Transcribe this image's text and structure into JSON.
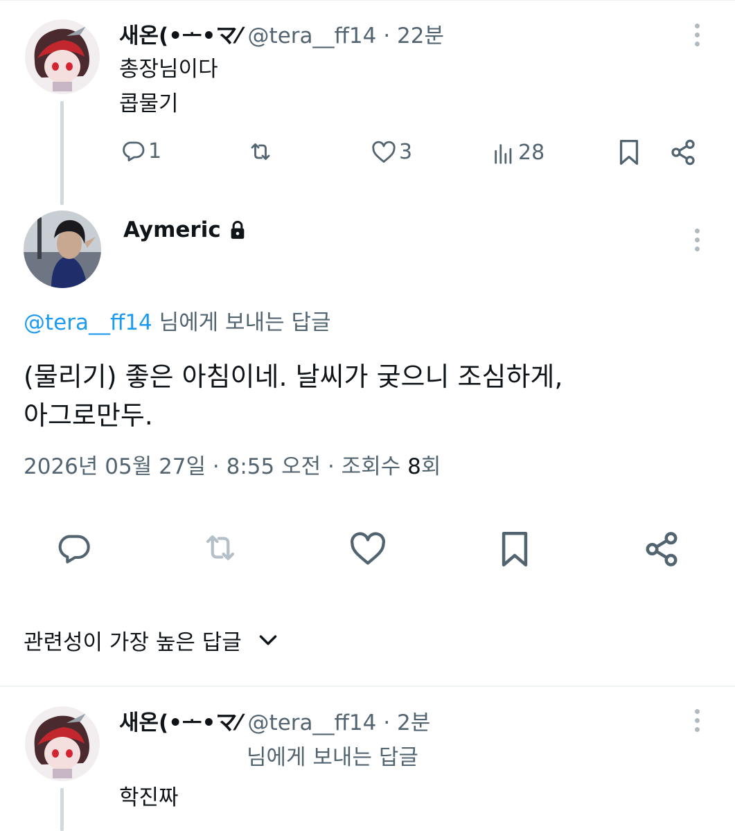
{
  "parent_tweet": {
    "display_name": "새온(•ᅩ•マ⁄",
    "handle": "@tera__ff14",
    "time": "· 22분",
    "lines": [
      "총장님이다",
      "콥물기"
    ],
    "reply_count": "1",
    "retweet_count": "",
    "like_count": "3",
    "view_count": "28"
  },
  "focus_tweet": {
    "display_name": "Aymeric",
    "reply_to_handle": "@tera__ff14",
    "reply_to_suffix": "님에게 보내는 답글",
    "lines": [
      "(물리기) 좋은 아침이네. 날씨가 궂으니 조심하게,",
      "아그로만두."
    ],
    "date_text": "2026년 05월 27일 · 8:55 오전 · 조회수 ",
    "views": "8",
    "views_suffix": "회"
  },
  "sort": {
    "label": "관련성이 가장 높은 답글"
  },
  "reply_tweet": {
    "display_name": "새온(•ᅩ•マ⁄",
    "handle": "@tera__ff14",
    "time": "· 2분",
    "reply_to_suffix": "님에게 보내는 답글",
    "text": "학진짜"
  },
  "icons": {
    "reply": "reply-icon",
    "retweet": "retweet-icon",
    "like": "heart-icon",
    "views": "views-icon",
    "bookmark": "bookmark-icon",
    "share": "share-icon",
    "lock": "lock-icon",
    "more": "more-icon",
    "chevron": "chevron-down-icon"
  },
  "colors": {
    "text": "#0f1419",
    "secondary": "#536471",
    "link": "#1d9bf0",
    "divider": "#eff3f4",
    "disabled": "#b4c0c8"
  }
}
